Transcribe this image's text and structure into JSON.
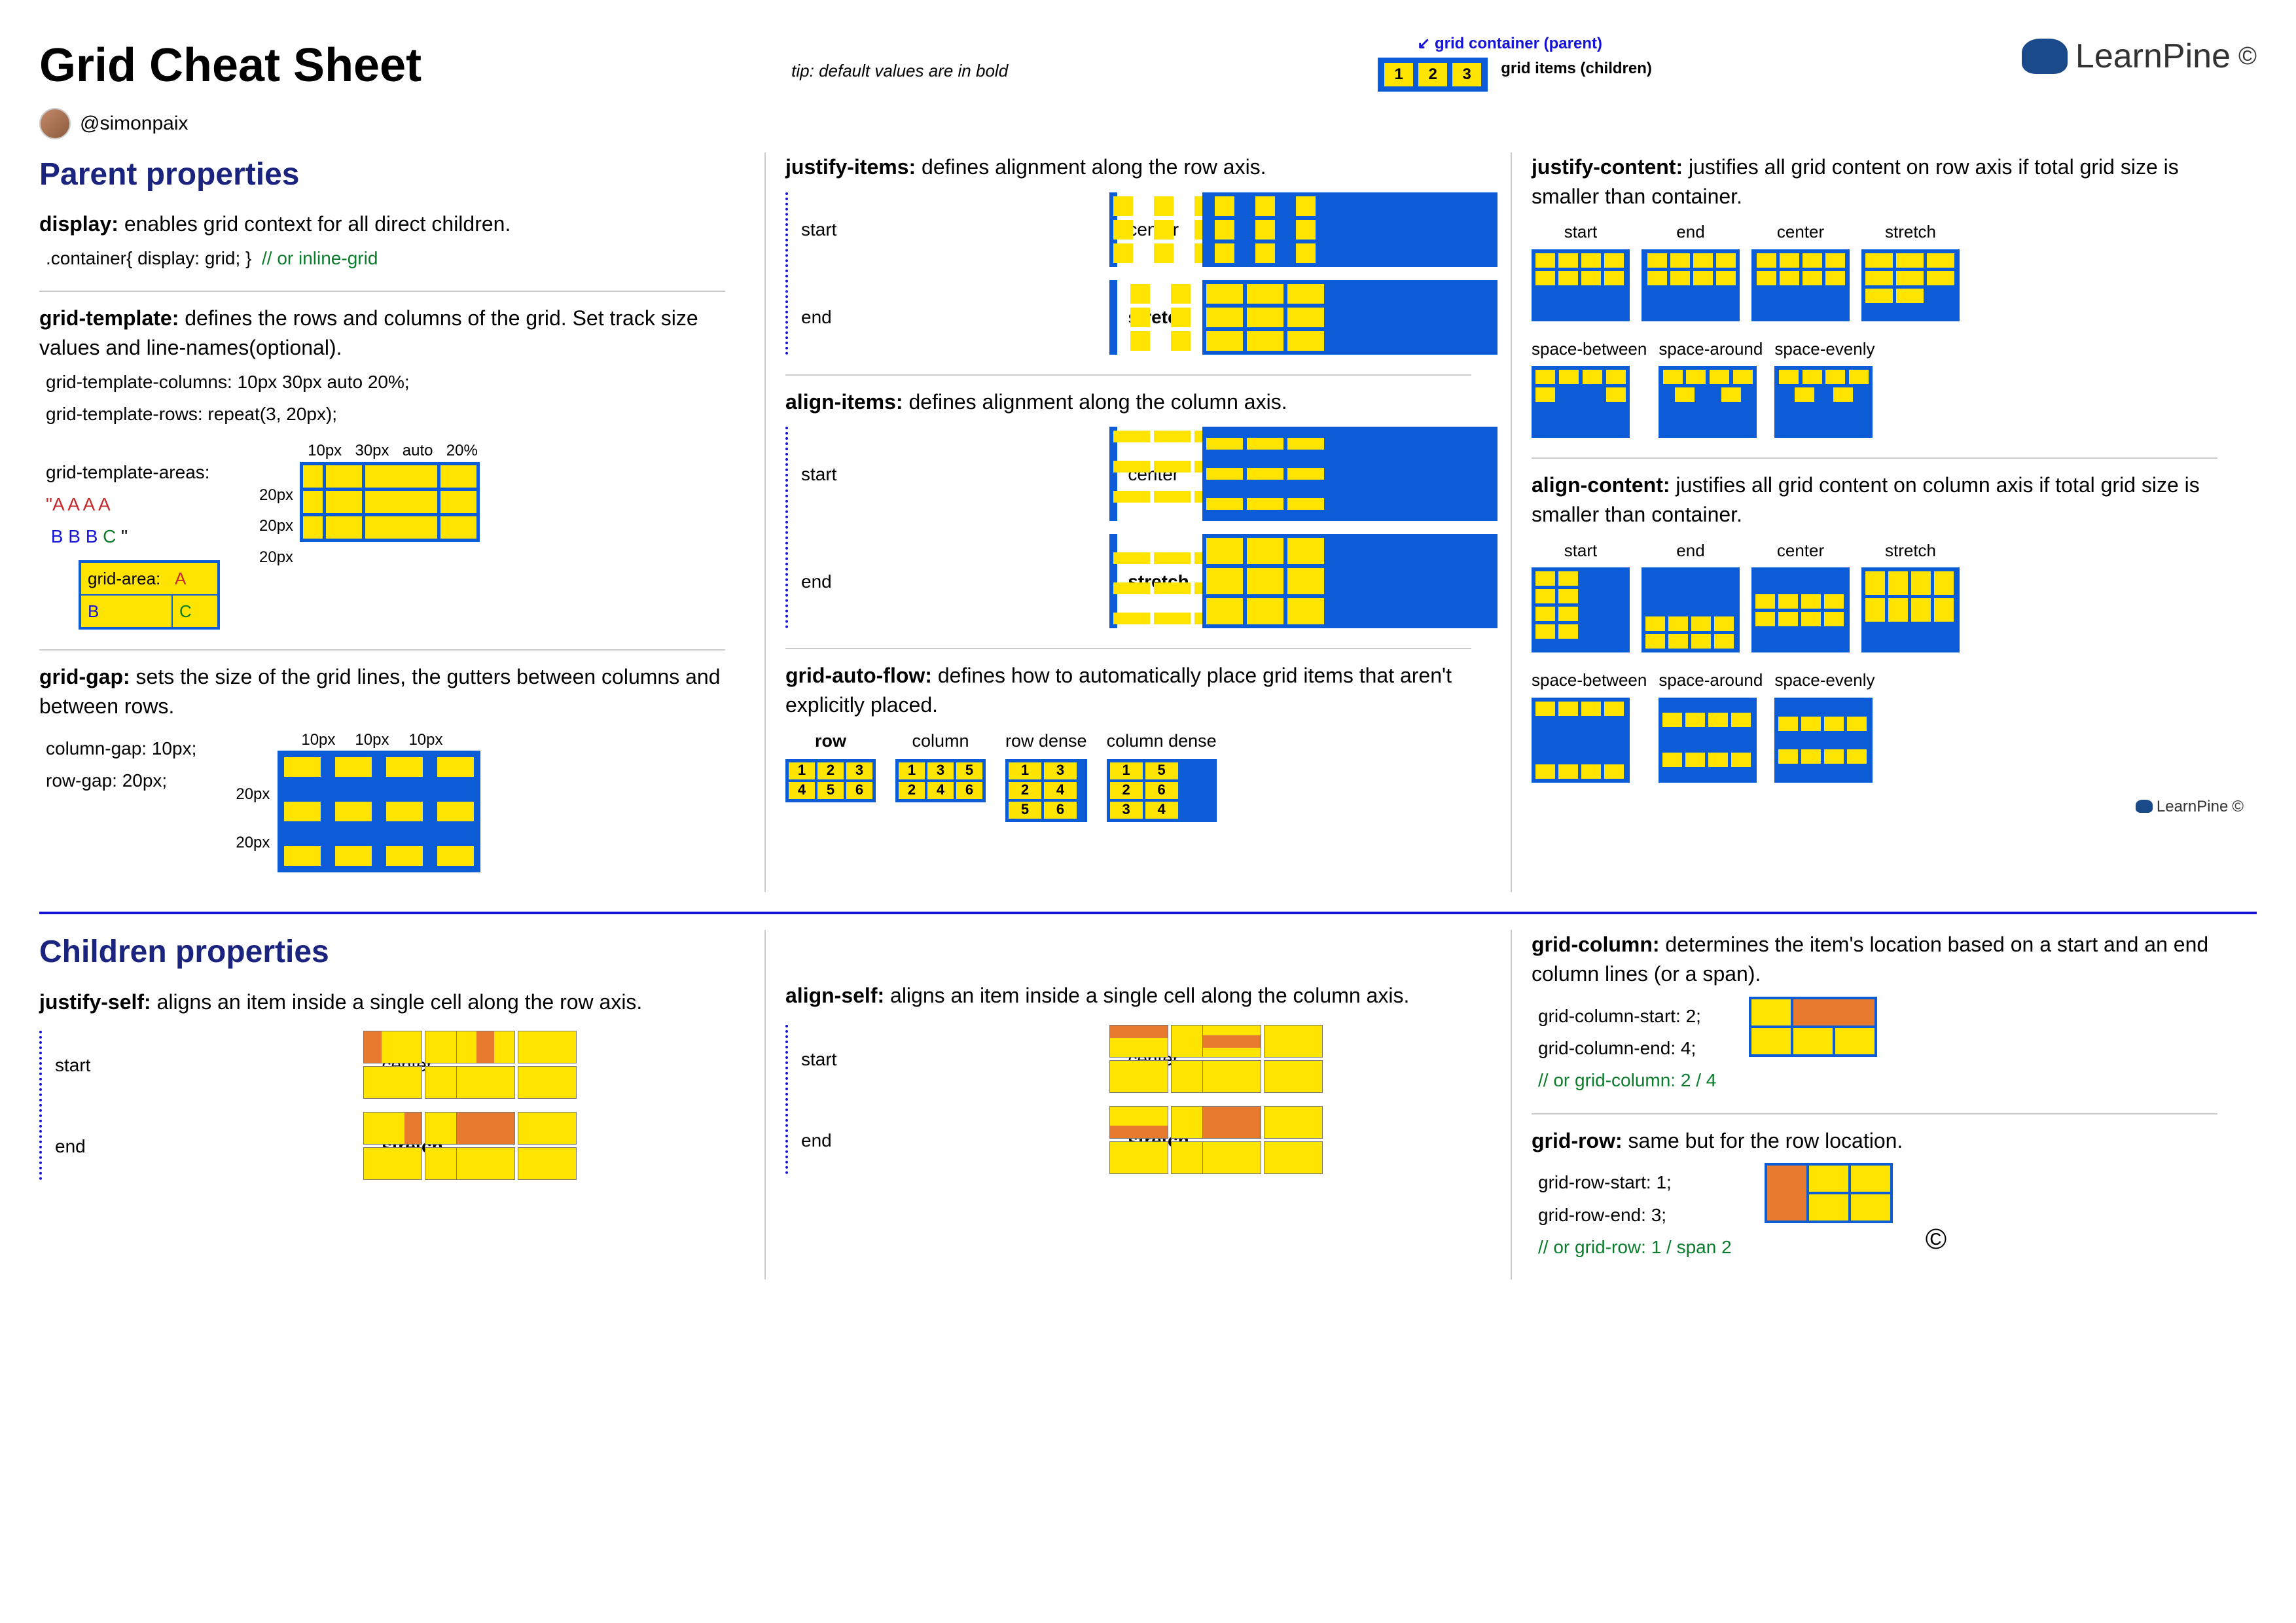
{
  "title": "Grid Cheat Sheet",
  "author": "@simonpaix",
  "tip": "tip: default values are in bold",
  "legend": {
    "container": "grid container (parent)",
    "items": "grid items (children)",
    "cells": [
      "1",
      "2",
      "3"
    ]
  },
  "brand": "LearnPine",
  "copyright": "©",
  "parent_heading": "Parent properties",
  "children_heading": "Children properties",
  "display": {
    "title": "display:",
    "desc": "enables grid context for all direct children.",
    "code": ".container{ display: grid; }",
    "comment": "// or inline-grid"
  },
  "grid_template": {
    "title": "grid-template:",
    "desc": "defines the rows and columns of the grid. Set track size values and line-names(optional).",
    "code1": "grid-template-columns: 10px 30px auto 20%;",
    "code2": "grid-template-rows: repeat(3, 20px);",
    "col_labels": [
      "10px",
      "30px",
      "auto",
      "20%"
    ],
    "row_labels": [
      "20px",
      "20px",
      "20px"
    ],
    "areas_title": "grid-template-areas:",
    "areas_line1": "\"A A A A",
    "areas_line2": " B B B C \"",
    "area_box": {
      "label": "grid-area:",
      "A": "A",
      "B": "B",
      "C": "C"
    }
  },
  "grid_gap": {
    "title": "grid-gap:",
    "desc": "sets the size of the grid lines, the gutters between columns and between rows.",
    "code1": "column-gap: 10px;",
    "code2": "row-gap: 20px;",
    "col_labels": [
      "10px",
      "10px",
      "10px"
    ],
    "row_labels": [
      "20px",
      "20px"
    ]
  },
  "justify_items": {
    "title": "justify-items:",
    "desc": "defines alignment along the row axis.",
    "opts": [
      "start",
      "center",
      "end",
      "stretch"
    ]
  },
  "align_items": {
    "title": "align-items:",
    "desc": "defines alignment along the column axis.",
    "opts": [
      "start",
      "center",
      "end",
      "stretch"
    ]
  },
  "grid_auto_flow": {
    "title": "grid-auto-flow:",
    "desc": "defines how to automatically place grid items that aren't explicitly placed.",
    "opts": [
      "row",
      "column",
      "row dense",
      "column dense"
    ],
    "row_cells": [
      "1",
      "2",
      "3",
      "4",
      "5",
      "6"
    ],
    "col_cells": [
      "1",
      "3",
      "5",
      "2",
      "4",
      "6"
    ],
    "rd_cells": [
      "1",
      "3",
      "2",
      "4",
      "5",
      "6"
    ],
    "cd_cells": [
      "1",
      "5",
      "2",
      "6",
      "3",
      "4"
    ]
  },
  "justify_content": {
    "title": "justify-content:",
    "desc": "justifies all grid content on row axis if total grid size is smaller than container.",
    "opts": [
      "start",
      "end",
      "center",
      "stretch",
      "space-between",
      "space-around",
      "space-evenly"
    ]
  },
  "align_content": {
    "title": "align-content:",
    "desc": "justifies all grid content on column axis if total grid size is smaller than container.",
    "opts": [
      "start",
      "end",
      "center",
      "stretch",
      "space-between",
      "space-around",
      "space-evenly"
    ]
  },
  "justify_self": {
    "title": "justify-self:",
    "desc": "aligns an item inside a single cell along the row axis.",
    "opts": [
      "start",
      "center",
      "end",
      "stretch"
    ]
  },
  "align_self": {
    "title": "align-self:",
    "desc": "aligns an item inside a single cell along the column axis.",
    "opts": [
      "start",
      "center",
      "end",
      "stretch"
    ]
  },
  "grid_column": {
    "title": "grid-column:",
    "desc": "determines the item's location based on a start and an end column lines (or a span).",
    "code1": "grid-column-start: 2;",
    "code2": "grid-column-end: 4;",
    "comment": "// or grid-column: 2 / 4"
  },
  "grid_row": {
    "title": "grid-row:",
    "desc": "same but for the row location.",
    "code1": "grid-row-start: 1;",
    "code2": "grid-row-end: 3;",
    "comment": "// or grid-row: 1 / span 2"
  }
}
